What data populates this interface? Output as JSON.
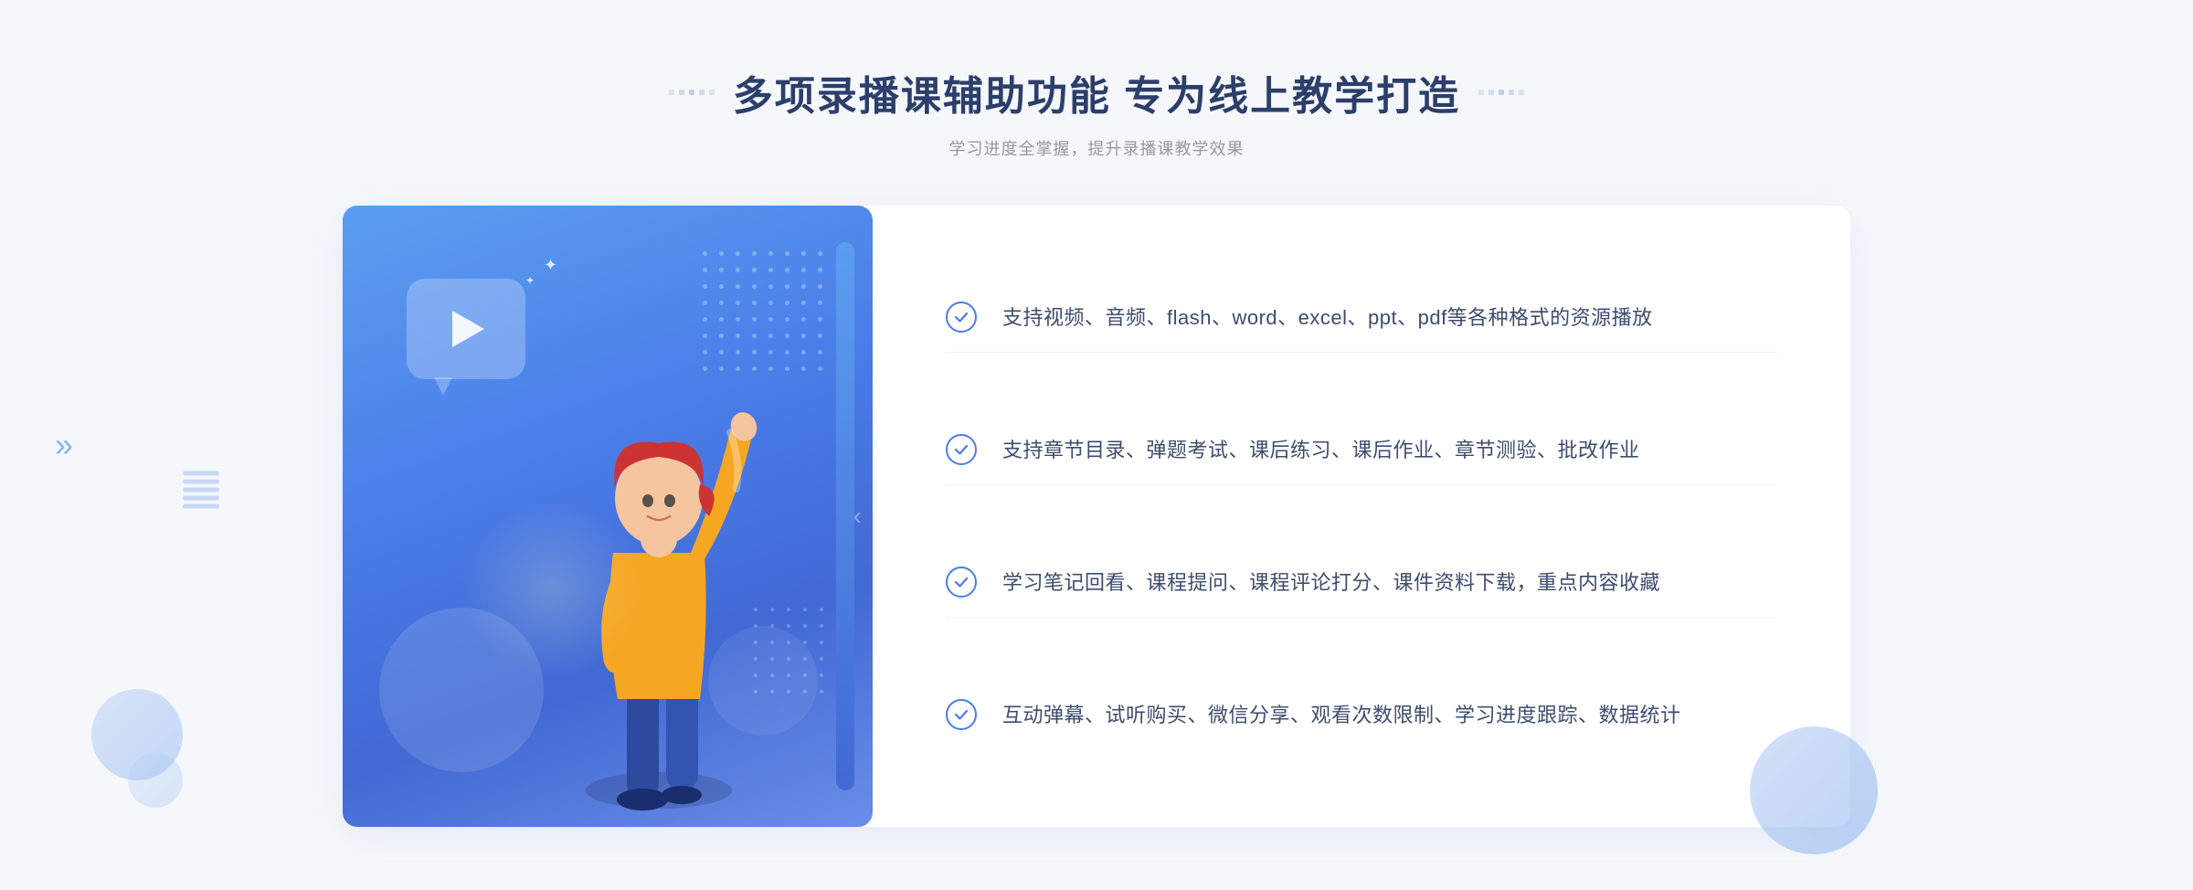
{
  "header": {
    "title": "多项录播课辅助功能 专为线上教学打造",
    "subtitle": "学习进度全掌握，提升录播课教学效果",
    "decoration_dots": 5
  },
  "features": [
    {
      "id": 1,
      "text": "支持视频、音频、flash、word、excel、ppt、pdf等各种格式的资源播放"
    },
    {
      "id": 2,
      "text": "支持章节目录、弹题考试、课后练习、课后作业、章节测验、批改作业"
    },
    {
      "id": 3,
      "text": "学习笔记回看、课程提问、课程评论打分、课件资料下载，重点内容收藏"
    },
    {
      "id": 4,
      "text": "互动弹幕、试听购买、微信分享、观看次数限制、学习进度跟踪、数据统计"
    }
  ],
  "colors": {
    "primary": "#4a7de8",
    "title": "#2c3e6b",
    "text": "#3d4d6e",
    "subtitle": "#999999",
    "bg": "#f5f7fa"
  }
}
